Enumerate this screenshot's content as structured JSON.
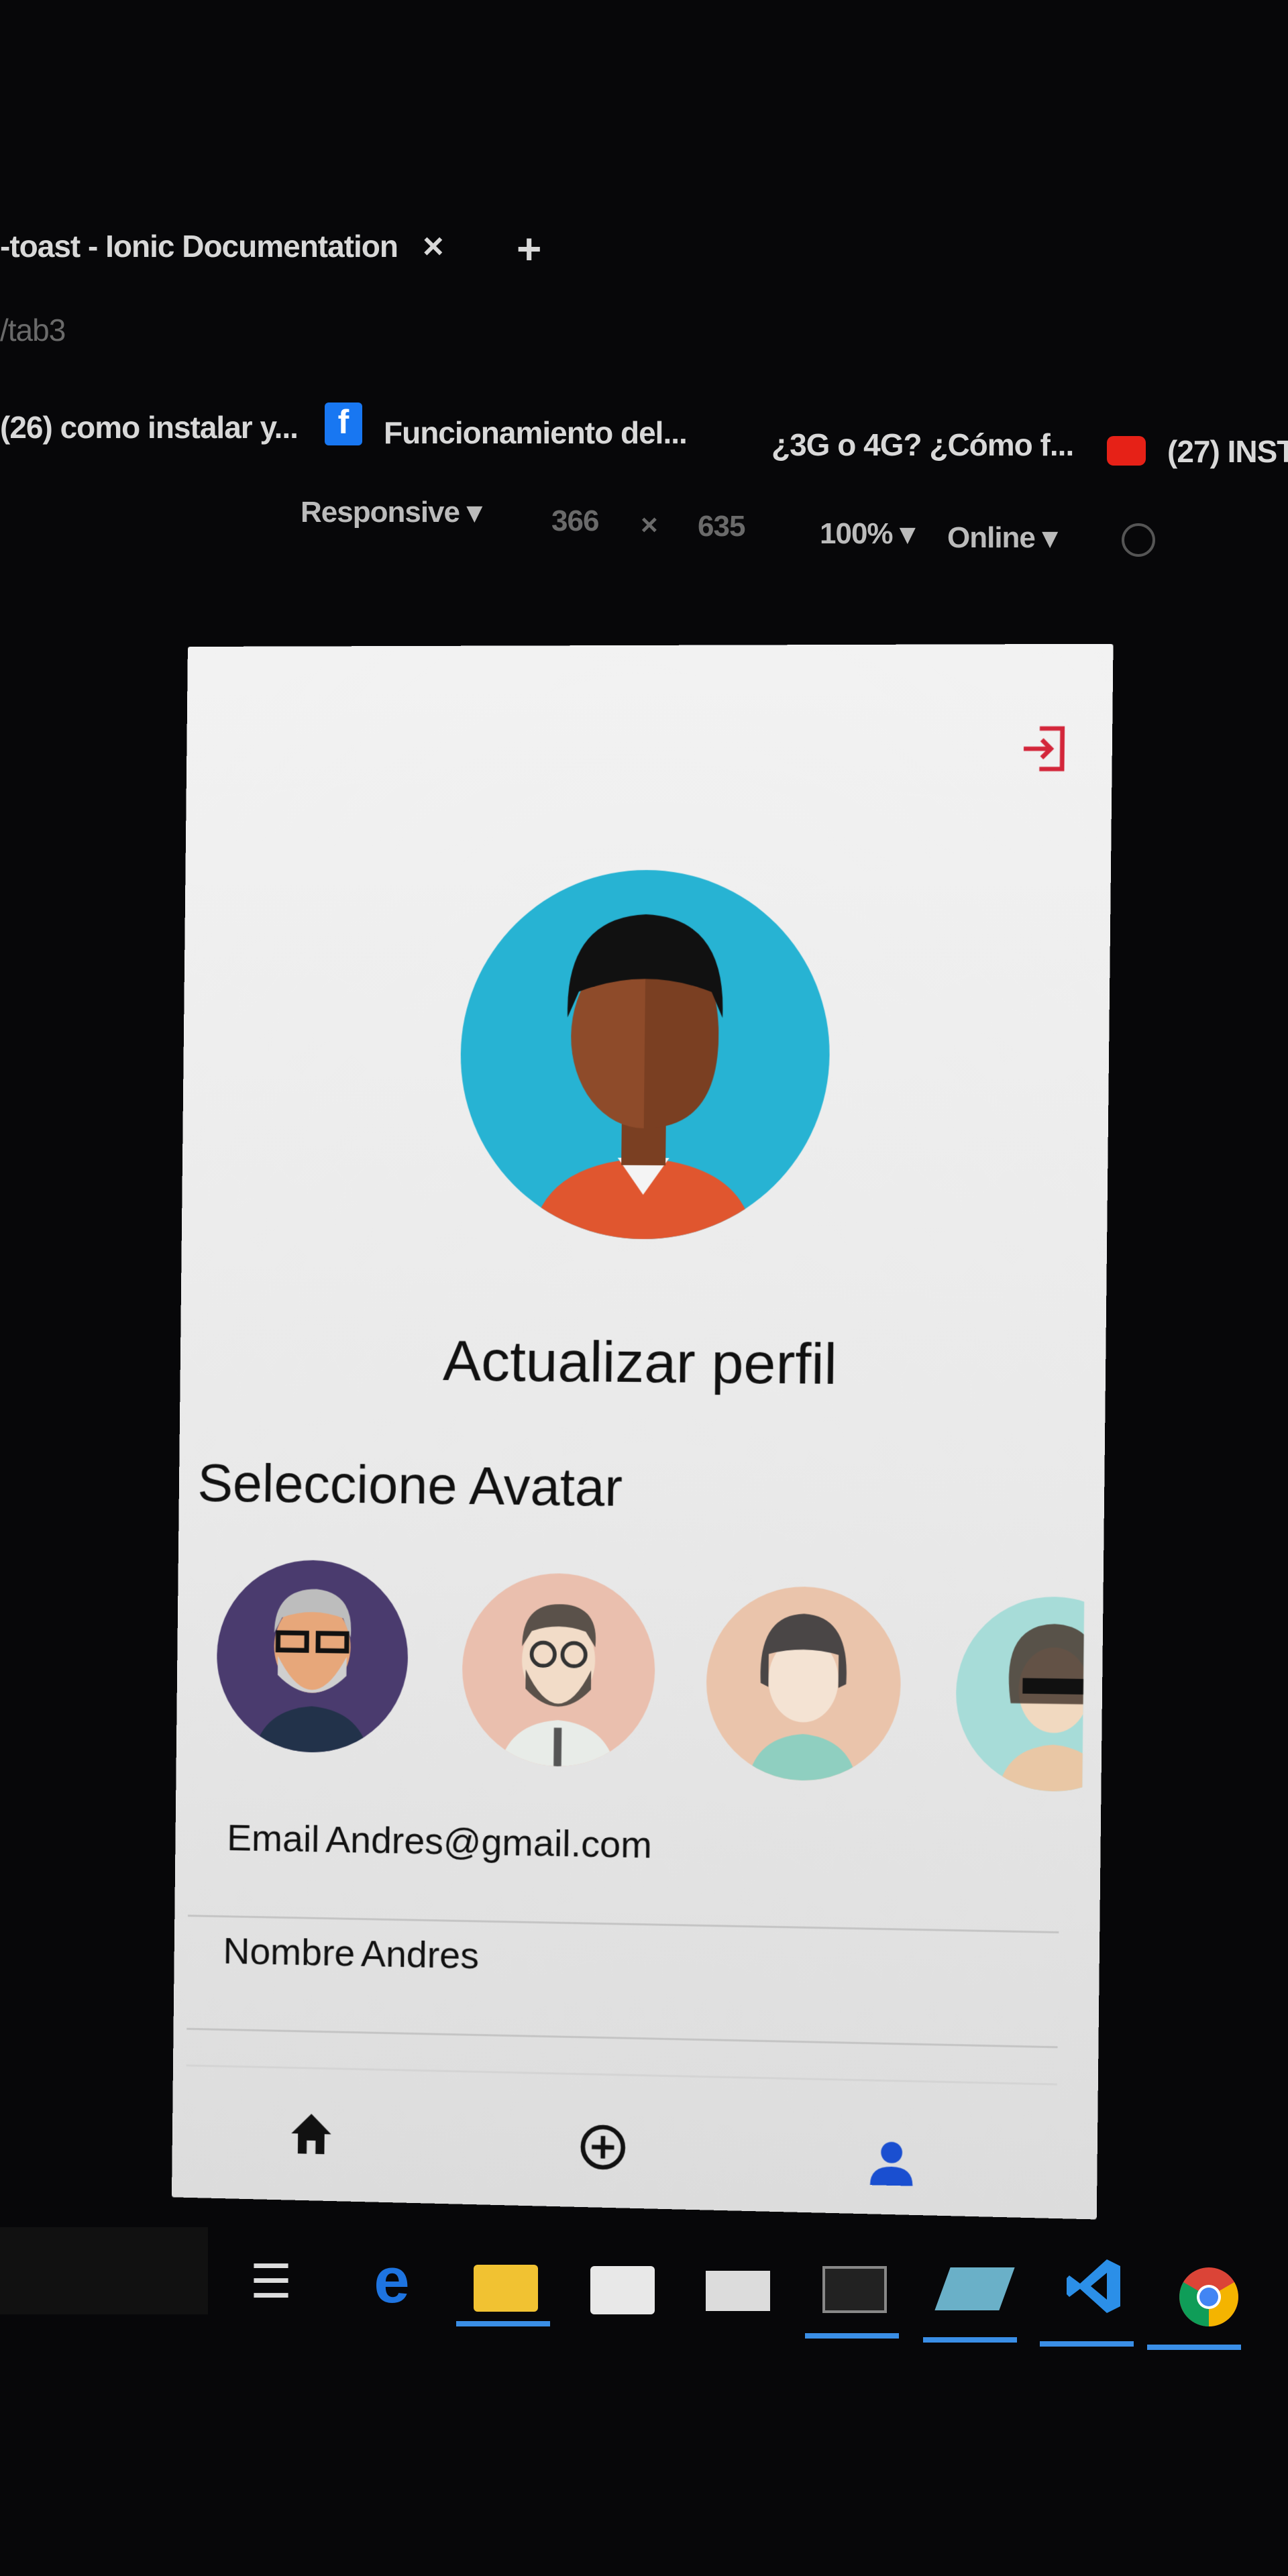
{
  "browser": {
    "tab_title": "-toast - Ionic Documentation",
    "tab_close": "×",
    "new_tab": "+",
    "url": "/tab3",
    "bookmarks": [
      "(26) como instalar y...",
      "Funcionamiento del...",
      "¿3G o 4G? ¿Cómo f...",
      "(27) INST"
    ]
  },
  "devtools": {
    "device": "Responsive ▾",
    "width": "366",
    "times": "×",
    "height": "635",
    "zoom": "100% ▾",
    "network": "Online ▾"
  },
  "app": {
    "title": "Actualizar perfil",
    "avatar_section": "Seleccione Avatar",
    "fields": [
      {
        "label": "Email",
        "value": "Andres@gmail.com"
      },
      {
        "label": "Nombre",
        "value": "Andres"
      }
    ],
    "tabs": [
      "home",
      "add",
      "profile"
    ],
    "active_color": "#1a4fd0",
    "logout_color": "#d3263a"
  },
  "taskbar": {
    "icons": [
      "task-view",
      "edge",
      "file-explorer",
      "store",
      "mail",
      "terminal",
      "app",
      "vscode",
      "chrome"
    ]
  }
}
